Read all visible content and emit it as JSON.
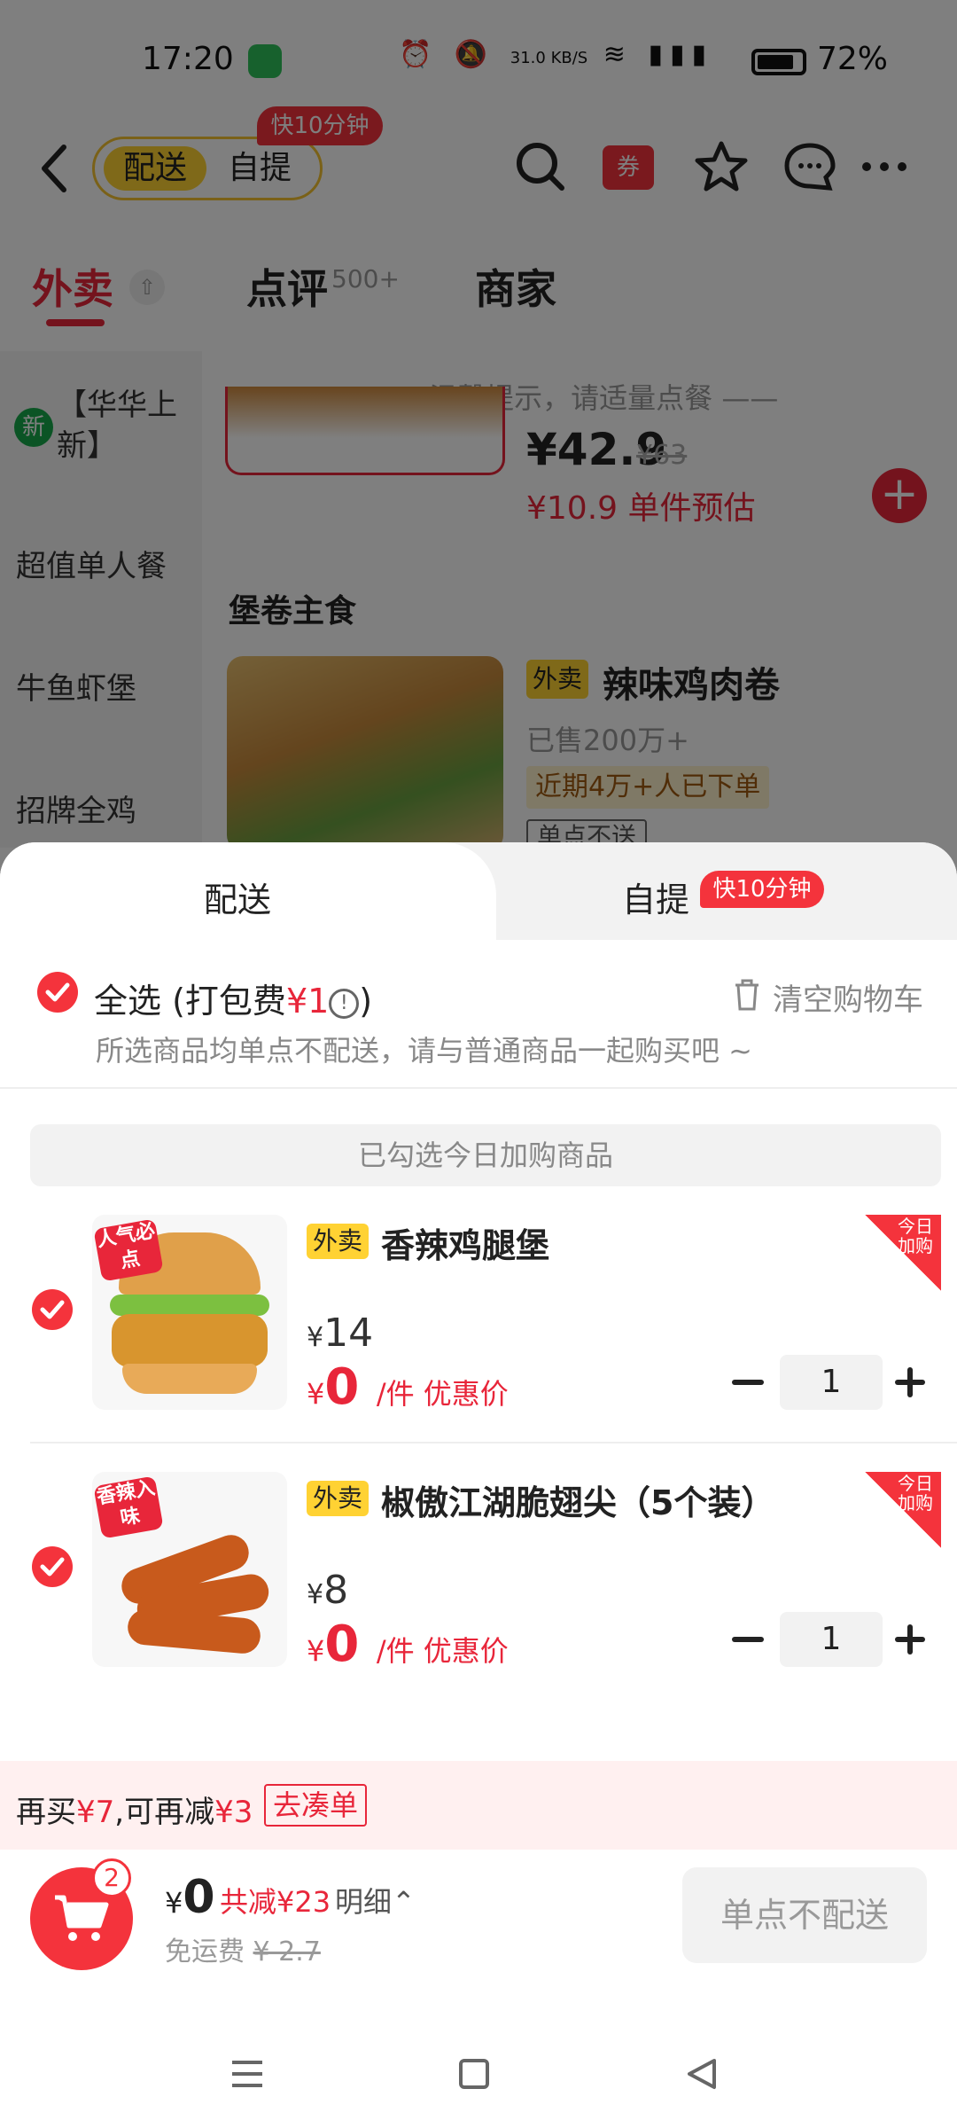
{
  "status_bar": {
    "time": "17:20",
    "net_speed": "31.0 KB/S",
    "battery": "72%"
  },
  "header": {
    "mode_active": "配送",
    "mode_other": "自提",
    "fast_badge": "快10分钟",
    "coupon": "券"
  },
  "tabs": [
    {
      "label": "外卖",
      "active": true
    },
    {
      "label": "点评",
      "sup": "500+"
    },
    {
      "label": "商家"
    }
  ],
  "sidebar": {
    "new_badge": "新",
    "items": [
      "【华华上新】",
      "超值单人餐",
      "牛鱼虾堡",
      "招牌全鸡"
    ]
  },
  "menu": {
    "tip": "—— 温馨提示，请适量点餐 ——",
    "prev_item": {
      "price": "¥42.9",
      "orig_price": "¥63",
      "est": "¥10.9 单件预估"
    },
    "section_title": "堡卷主食",
    "item": {
      "tag": "外卖",
      "name": "辣味鸡肉卷",
      "sold": "已售200万+",
      "recent": "近期4万+人已下单",
      "no_single": "单点不送"
    }
  },
  "sheet": {
    "tab_delivery": "配送",
    "tab_pickup": "自提",
    "pickup_badge": "快10分钟",
    "select_all": "全选",
    "pack_fee_prefix": "(打包费",
    "pack_fee_value": "¥1",
    "pack_fee_suffix": ")",
    "clear_cart": "清空购物车",
    "notice": "所选商品均单点不配送，请与普通商品一起购买吧 ~",
    "banner": "已勾选今日加购商品",
    "items": [
      {
        "tag": "外卖",
        "name": "香辣鸡腿堡",
        "corner": "今日加购",
        "sticker": "人气必点",
        "orig_price": "14",
        "deal_price": "0",
        "deal_suffix": "/件 优惠价",
        "qty": "1"
      },
      {
        "tag": "外卖",
        "name": "椒傲江湖脆翅尖（5个装）",
        "corner": "今日加购",
        "sticker": "香辣入味",
        "orig_price": "8",
        "deal_price": "0",
        "deal_suffix": "/件 优惠价",
        "qty": "1"
      }
    ],
    "promo": {
      "text_a": "再买",
      "amount_a": "¥7",
      "text_b": ",可再减",
      "amount_b": "¥3",
      "button": "去凑单"
    },
    "footer": {
      "cart_count": "2",
      "total_symbol": "¥",
      "total": "0",
      "saved": "共减¥23",
      "detail": "明细⌃",
      "shipping_label": "免运费",
      "shipping_orig": "¥ 2.7",
      "checkout": "单点不配送"
    }
  },
  "colors": {
    "accent": "#f4333c",
    "brand_yellow": "#ffd233"
  }
}
